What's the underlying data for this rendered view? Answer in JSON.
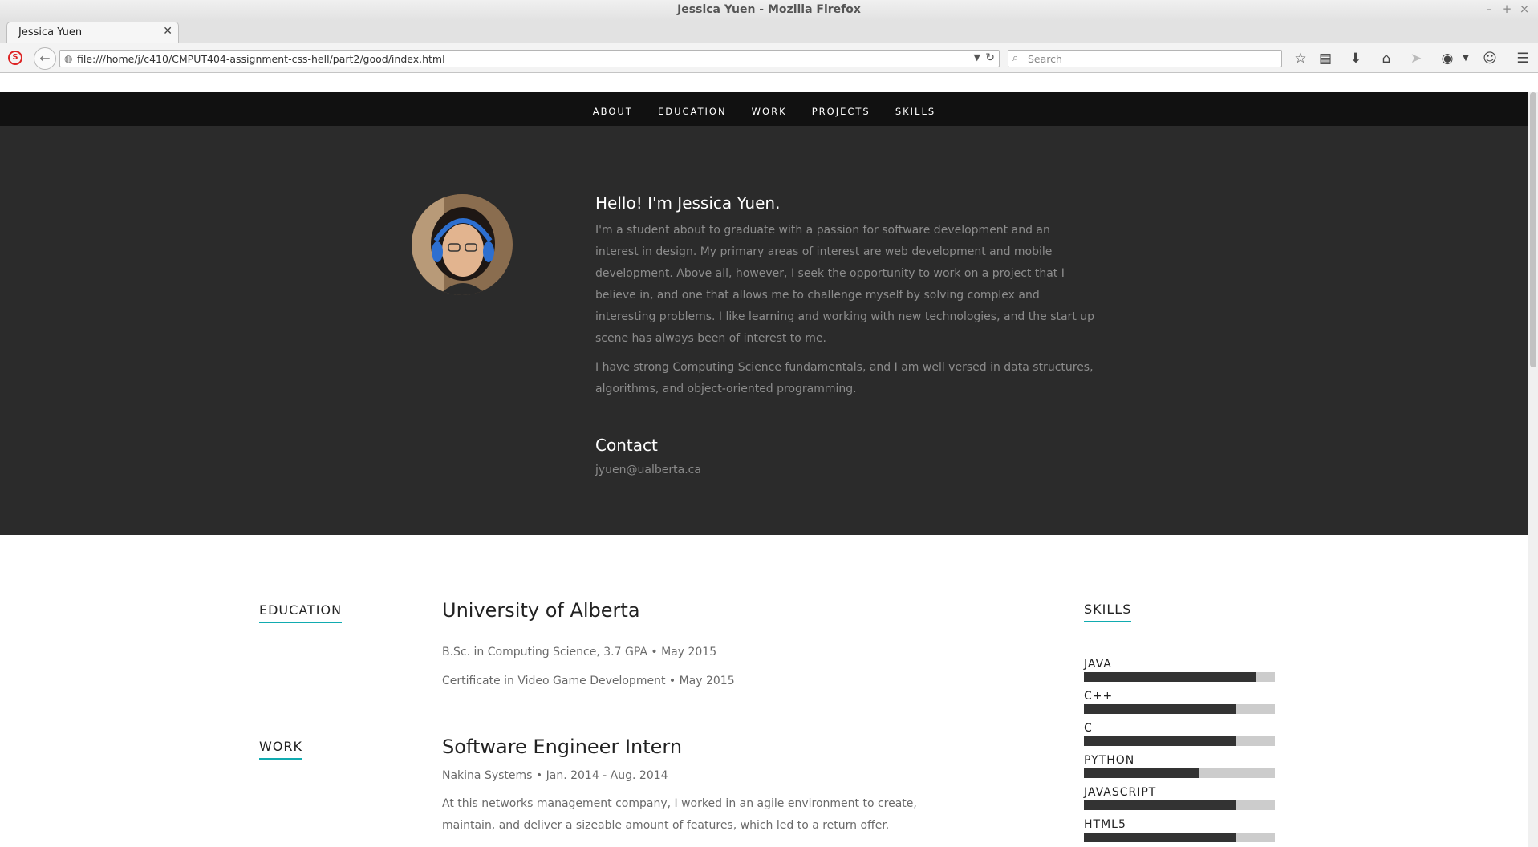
{
  "window": {
    "title": "Jessica Yuen - Mozilla Firefox"
  },
  "browser": {
    "tab_title": "Jessica Yuen",
    "url": "file:///home/j/c410/CMPUT404-assignment-css-hell/part2/good/index.html",
    "search_placeholder": "Search"
  },
  "nav": {
    "items": [
      "ABOUT",
      "EDUCATION",
      "WORK",
      "PROJECTS",
      "SKILLS"
    ]
  },
  "about": {
    "greeting": "Hello! I'm Jessica Yuen.",
    "bio1": "I'm a student about to graduate with a passion for software development and an interest in design. My primary areas of interest are web development and mobile development. Above all, however, I seek the opportunity to work on a project that I believe in, and one that allows me to challenge myself by solving complex and interesting problems. I like learning and working with new technologies, and the start up scene has always been of interest to me.",
    "bio2": "I have strong Computing Science fundamentals, and I am well versed in data structures, algorithms, and object-oriented programming.",
    "contact_heading": "Contact",
    "email": "jyuen@ualberta.ca"
  },
  "education": {
    "heading": "EDUCATION",
    "school": "University of Alberta",
    "degree": "B.Sc. in Computing Science, 3.7 GPA • May 2015",
    "certificate": "Certificate in Video Game Development • May 2015"
  },
  "work": {
    "heading": "WORK",
    "title": "Software Engineer Intern",
    "meta": "Nakina Systems •  Jan. 2014 - Aug. 2014",
    "desc": "At this networks management company, I worked in an agile environment to create, maintain, and deliver a sizeable amount of features, which led to a return offer."
  },
  "skills": {
    "heading": "SKILLS",
    "items": [
      {
        "name": "JAVA",
        "level": 0.9
      },
      {
        "name": "C++",
        "level": 0.8
      },
      {
        "name": "C",
        "level": 0.8
      },
      {
        "name": "PYTHON",
        "level": 0.6
      },
      {
        "name": "JAVASCRIPT",
        "level": 0.8
      },
      {
        "name": "HTML5",
        "level": 0.8
      }
    ]
  },
  "colors": {
    "accent": "#11abb0",
    "hero_bg": "#2b2b2b",
    "nav_bg": "#111111"
  }
}
